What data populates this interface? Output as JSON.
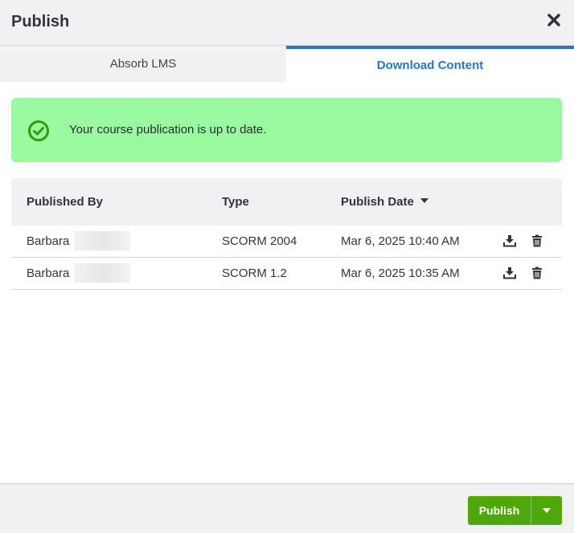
{
  "dialog": {
    "title": "Publish",
    "close_icon": "close-icon"
  },
  "tabs": [
    {
      "label": "Absorb LMS",
      "active": false
    },
    {
      "label": "Download Content",
      "active": true
    }
  ],
  "alert": {
    "icon": "check-circle-icon",
    "text": "Your course publication is up to date.",
    "color": "#99f99e"
  },
  "table": {
    "columns": [
      "Published By",
      "Type",
      "Publish Date"
    ],
    "sort_column": "Publish Date",
    "rows": [
      {
        "published_by": "Barbara",
        "type": "SCORM 2004",
        "date": "Mar 6, 2025 10:40 AM"
      },
      {
        "published_by": "Barbara",
        "type": "SCORM 1.2",
        "date": "Mar 6, 2025 10:35 AM"
      }
    ]
  },
  "footer": {
    "publish_label": "Publish",
    "accent": "#4fa80a"
  },
  "colors": {
    "active_tab": "#1f78c8"
  }
}
